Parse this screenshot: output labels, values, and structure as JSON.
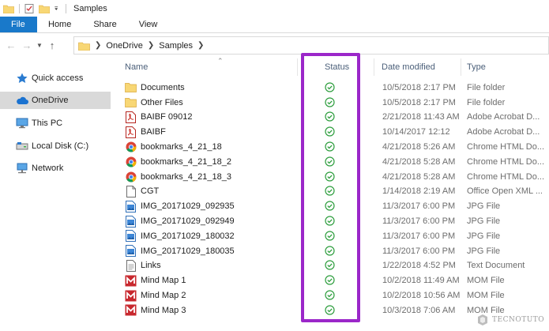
{
  "window": {
    "title": "Samples"
  },
  "ribbon": {
    "tabs": [
      "File",
      "Home",
      "Share",
      "View"
    ]
  },
  "address": {
    "crumbs": [
      "OneDrive",
      "Samples"
    ]
  },
  "nav": {
    "items": [
      {
        "label": "Quick access",
        "icon": "star-icon"
      },
      {
        "label": "OneDrive",
        "icon": "cloud-icon",
        "selected": true
      },
      {
        "label": "This PC",
        "icon": "monitor-icon"
      },
      {
        "label": "Local Disk (C:)",
        "icon": "drive-icon"
      },
      {
        "label": "Network",
        "icon": "network-icon"
      }
    ]
  },
  "columns": {
    "name": "Name",
    "status": "Status",
    "date": "Date modified",
    "type": "Type"
  },
  "files": [
    {
      "name": "Documents",
      "date": "10/5/2018 2:17 PM",
      "type": "File folder",
      "icon": "folder-icon"
    },
    {
      "name": "Other Files",
      "date": "10/5/2018 2:17 PM",
      "type": "File folder",
      "icon": "folder-icon"
    },
    {
      "name": "BAIBF 09012",
      "date": "2/21/2018 11:43 AM",
      "type": "Adobe Acrobat D...",
      "icon": "pdf-icon"
    },
    {
      "name": "BAIBF",
      "date": "10/14/2017 12:12",
      "type": "Adobe Acrobat D...",
      "icon": "pdf-icon"
    },
    {
      "name": "bookmarks_4_21_18",
      "date": "4/21/2018 5:26 AM",
      "type": "Chrome HTML Do...",
      "icon": "chrome-icon"
    },
    {
      "name": "bookmarks_4_21_18_2",
      "date": "4/21/2018 5:28 AM",
      "type": "Chrome HTML Do...",
      "icon": "chrome-icon"
    },
    {
      "name": "bookmarks_4_21_18_3",
      "date": "4/21/2018 5:28 AM",
      "type": "Chrome HTML Do...",
      "icon": "chrome-icon"
    },
    {
      "name": "CGT",
      "date": "1/14/2018 2:19 AM",
      "type": "Office Open XML ...",
      "icon": "document-icon"
    },
    {
      "name": "IMG_20171029_092935",
      "date": "11/3/2017 6:00 PM",
      "type": "JPG File",
      "icon": "image-icon"
    },
    {
      "name": "IMG_20171029_092949",
      "date": "11/3/2017 6:00 PM",
      "type": "JPG File",
      "icon": "image-icon"
    },
    {
      "name": "IMG_20171029_180032",
      "date": "11/3/2017 6:00 PM",
      "type": "JPG File",
      "icon": "image-icon"
    },
    {
      "name": "IMG_20171029_180035",
      "date": "11/3/2017 6:00 PM",
      "type": "JPG File",
      "icon": "image-icon"
    },
    {
      "name": "Links",
      "date": "1/22/2018 4:52 PM",
      "type": "Text Document",
      "icon": "text-icon"
    },
    {
      "name": "Mind Map 1",
      "date": "10/2/2018 11:49 AM",
      "type": "MOM File",
      "icon": "mindmap-icon"
    },
    {
      "name": "Mind Map 2",
      "date": "10/2/2018 10:56 AM",
      "type": "MOM File",
      "icon": "mindmap-icon"
    },
    {
      "name": "Mind Map 3",
      "date": "10/3/2018 7:06 AM",
      "type": "MOM File",
      "icon": "mindmap-icon"
    }
  ],
  "watermark": {
    "text": "TECNOTUTO"
  },
  "colors": {
    "accent": "#1979ca",
    "highlight": "#9b27c9",
    "synced": "#2e9e3e",
    "folder": "#f8d775"
  }
}
